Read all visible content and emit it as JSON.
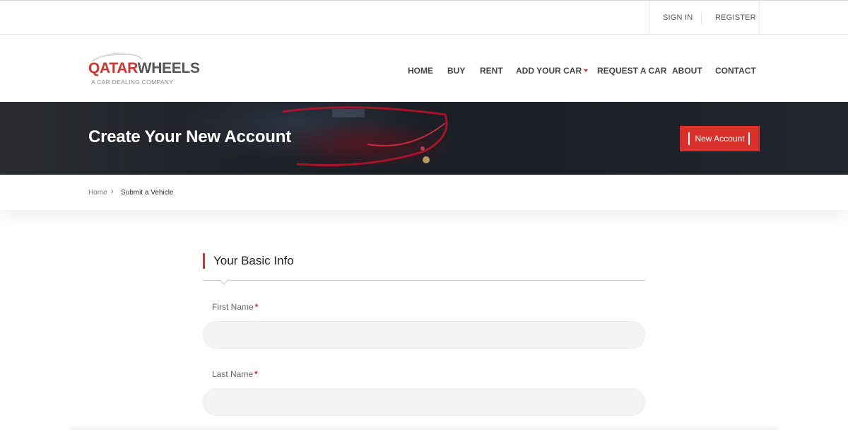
{
  "topbar": {
    "signin": "SIGN IN",
    "register": "REGISTER"
  },
  "logo": {
    "part1": "QATAR",
    "part2": "WHEELS",
    "tagline": "A CAR DEALING COMPANY"
  },
  "nav": {
    "items": [
      {
        "label": "HOME"
      },
      {
        "label": "BUY"
      },
      {
        "label": "RENT"
      },
      {
        "label": "ADD YOUR CAR",
        "dropdown": true
      },
      {
        "label": "REQUEST A CAR"
      },
      {
        "label": "ABOUT"
      },
      {
        "label": "CONTACT"
      }
    ]
  },
  "banner": {
    "title": "Create Your New Account",
    "button": "New Account"
  },
  "breadcrumb": {
    "home": "Home",
    "separator": "›",
    "current": "Submit a Vehicle"
  },
  "form": {
    "section_title": "Your Basic Info",
    "fields": [
      {
        "label": "First Name",
        "required_mark": "*",
        "value": "",
        "placeholder": ""
      },
      {
        "label": "Last Name",
        "required_mark": "*",
        "value": "",
        "placeholder": ""
      }
    ]
  },
  "colors": {
    "accent": "#d9302b",
    "text_dark": "#444444",
    "input_bg": "#f4f4f4"
  }
}
